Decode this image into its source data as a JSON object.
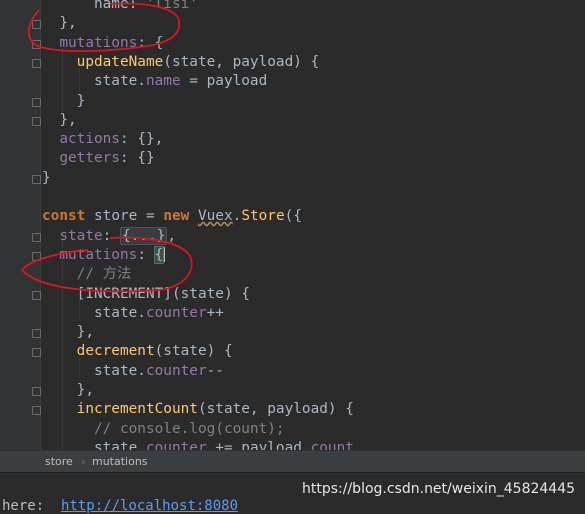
{
  "editor": {
    "lines": [
      [
        {
          "t": "      name: ",
          "c": "plain"
        },
        {
          "t": "'lisi'",
          "c": "cmt"
        }
      ],
      [
        {
          "t": "  },",
          "c": "plain"
        }
      ],
      [
        {
          "t": "  mutations",
          "c": "prop"
        },
        {
          "t": ": {",
          "c": "plain"
        }
      ],
      [
        {
          "t": "    ",
          "c": "plain"
        },
        {
          "t": "updateName",
          "c": "fn"
        },
        {
          "t": "(state, payload) {",
          "c": "plain"
        }
      ],
      [
        {
          "t": "      state.",
          "c": "plain"
        },
        {
          "t": "name",
          "c": "prop"
        },
        {
          "t": " = payload",
          "c": "plain"
        }
      ],
      [
        {
          "t": "    }",
          "c": "plain"
        }
      ],
      [
        {
          "t": "  },",
          "c": "plain"
        }
      ],
      [
        {
          "t": "  actions",
          "c": "prop"
        },
        {
          "t": ": {},",
          "c": "plain"
        }
      ],
      [
        {
          "t": "  getters",
          "c": "prop"
        },
        {
          "t": ": {}",
          "c": "plain"
        }
      ],
      [
        {
          "t": "}",
          "c": "plain"
        }
      ],
      [],
      [
        {
          "t": "const",
          "c": "kw"
        },
        {
          "t": " store = ",
          "c": "plain"
        },
        {
          "t": "new",
          "c": "kw"
        },
        {
          "t": " ",
          "c": "plain"
        },
        {
          "t": "Vuex",
          "c": "wavy"
        },
        {
          "t": ".",
          "c": "plain"
        },
        {
          "t": "Store",
          "c": "fn2"
        },
        {
          "t": "({",
          "c": "plain"
        }
      ],
      [
        {
          "t": "  state",
          "c": "prop"
        },
        {
          "t": ": ",
          "c": "plain"
        },
        {
          "t": "{...}",
          "c": "folded"
        },
        {
          "t": ",",
          "c": "plain"
        }
      ],
      [
        {
          "t": "  mutations",
          "c": "prop"
        },
        {
          "t": ": ",
          "c": "plain"
        },
        {
          "t": "{",
          "c": "bracehl"
        }
      ],
      [
        {
          "t": "    // 方法",
          "c": "cmt"
        }
      ],
      [
        {
          "t": "    [INCREMENT](state) {",
          "c": "plain"
        }
      ],
      [
        {
          "t": "      state.",
          "c": "plain"
        },
        {
          "t": "counter",
          "c": "prop"
        },
        {
          "t": "++",
          "c": "plain"
        }
      ],
      [
        {
          "t": "    },",
          "c": "plain"
        }
      ],
      [
        {
          "t": "    ",
          "c": "plain"
        },
        {
          "t": "decrement",
          "c": "fn"
        },
        {
          "t": "(state) {",
          "c": "plain"
        }
      ],
      [
        {
          "t": "      state.",
          "c": "plain"
        },
        {
          "t": "counter",
          "c": "prop"
        },
        {
          "t": "--",
          "c": "plain"
        }
      ],
      [
        {
          "t": "    },",
          "c": "plain"
        }
      ],
      [
        {
          "t": "    ",
          "c": "plain"
        },
        {
          "t": "incrementCount",
          "c": "fn"
        },
        {
          "t": "(state, payload) {",
          "c": "plain"
        }
      ],
      [
        {
          "t": "      // console.log(count);",
          "c": "cmt"
        }
      ],
      [
        {
          "t": "      state.",
          "c": "plain"
        },
        {
          "t": "counter",
          "c": "prop"
        },
        {
          "t": " += payload.",
          "c": "plain"
        },
        {
          "t": "count",
          "c": "prop"
        }
      ]
    ]
  },
  "breadcrumbs": [
    "store",
    "mutations"
  ],
  "status": {
    "prefix": "here:  ",
    "link": "http://localhost:8080"
  },
  "watermark": "https://blog.csdn.net/weixin_45824445",
  "colors": {
    "background": "#2b2b2b",
    "keyword": "#cc7832",
    "function": "#ffc66d",
    "property": "#9876aa",
    "comment": "#808080",
    "annotation": "#e0151b"
  }
}
